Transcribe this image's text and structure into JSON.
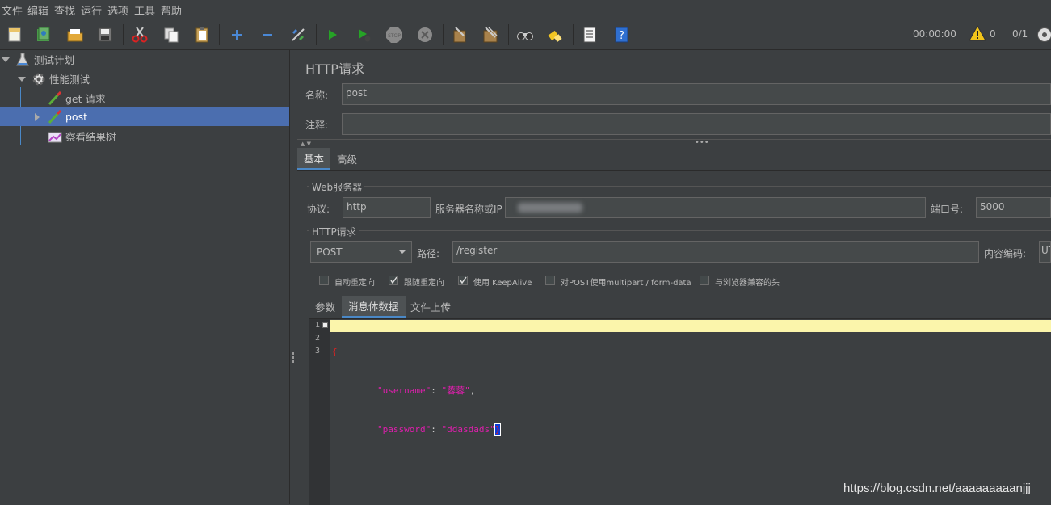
{
  "menu": [
    "文件",
    "编辑",
    "查找",
    "运行",
    "选项",
    "工具",
    "帮助"
  ],
  "toolbar": {
    "icons": [
      "new-icon",
      "templates-icon",
      "open-icon",
      "save-icon",
      "cut-icon",
      "copy-icon",
      "paste-icon",
      "expand-icon",
      "collapse-icon",
      "toggle-icon",
      "start-icon",
      "start-no-pause-icon",
      "stop-icon",
      "shutdown-icon",
      "clear-icon",
      "clear-all-icon",
      "search-icon",
      "reset-search-icon",
      "function-helper-icon",
      "help-icon"
    ],
    "timer": "00:00:00",
    "warnings": "0",
    "threads": "0/1"
  },
  "tree": [
    {
      "label": "测试计划",
      "icon": "test-plan-icon",
      "expand": "down"
    },
    {
      "label": "性能测试",
      "icon": "thread-group-gear-icon",
      "expand": "down"
    },
    {
      "label": "get 请求",
      "icon": "sampler-pipette-icon",
      "expand": "none"
    },
    {
      "label": "post",
      "icon": "sampler-pipette-icon",
      "expand": "right",
      "selected": true
    },
    {
      "label": "察看结果树",
      "icon": "listener-graph-icon",
      "expand": "none"
    }
  ],
  "panel": {
    "title": "HTTP请求",
    "name_label": "名称:",
    "name_value": "post",
    "comment_label": "注释:",
    "comment_value": "",
    "tabs": [
      "基本",
      "高级"
    ],
    "web_server_title": "Web服务器",
    "protocol_label": "协议:",
    "protocol_value": "http",
    "server_label": "服务器名称或IP",
    "port_label": "端口号:",
    "port_value": "5000",
    "http_request_title": "HTTP请求",
    "method_value": "POST",
    "path_label": "路径:",
    "path_value": "/register",
    "encoding_label": "内容编码:",
    "encoding_value": "UT",
    "checkboxes": [
      {
        "label": "自动重定向",
        "checked": false
      },
      {
        "label": "跟随重定向",
        "checked": true
      },
      {
        "label": "使用 KeepAlive",
        "checked": true
      },
      {
        "label": "对POST使用multipart / form-data",
        "checked": false
      },
      {
        "label": "与浏览器兼容的头",
        "checked": false
      }
    ],
    "subtabs": [
      "参数",
      "消息体数据",
      "文件上传"
    ],
    "editor": {
      "line_numbers": [
        "1",
        "2",
        "3"
      ],
      "line1": "{",
      "line2_key": "\"username\"",
      "line2_sep": ": ",
      "line2_val": "\"蓉蓉\"",
      "line2_end": ",",
      "line3_key": "\"password\"",
      "line3_sep": ": ",
      "line3_val": "\"ddasdads\"",
      "line3_end": "}"
    }
  },
  "watermark": "https://blog.csdn.net/aaaaaaaaanjjj",
  "colors": {
    "background": "#3c3f41",
    "selection": "#4b6eaf",
    "editor_highlight": "#fbf5ab",
    "string_color": "#e01eae"
  }
}
